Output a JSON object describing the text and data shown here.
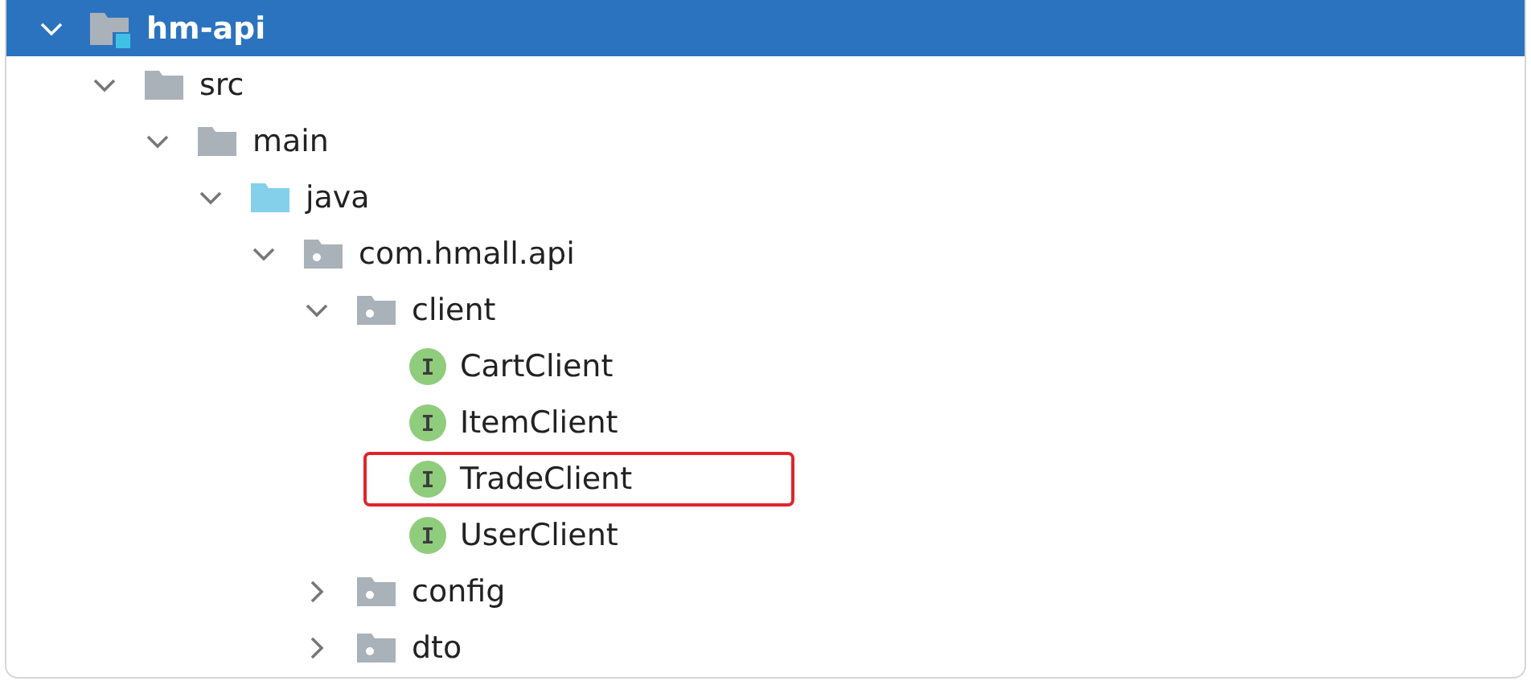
{
  "tree": {
    "label": "hm-api",
    "kind": "module",
    "expanded": true,
    "selected": true,
    "children": [
      {
        "label": "src",
        "kind": "folder",
        "expanded": true,
        "selected": false,
        "children": [
          {
            "label": "main",
            "kind": "folder",
            "expanded": true,
            "selected": false,
            "children": [
              {
                "label": "java",
                "kind": "source_root",
                "expanded": true,
                "selected": false,
                "children": [
                  {
                    "label": "com.hmall.api",
                    "kind": "package",
                    "expanded": true,
                    "selected": false,
                    "children": [
                      {
                        "label": "client",
                        "kind": "package",
                        "expanded": true,
                        "selected": false,
                        "children": [
                          {
                            "label": "CartClient",
                            "kind": "interface",
                            "selected": false,
                            "highlighted": false
                          },
                          {
                            "label": "ItemClient",
                            "kind": "interface",
                            "selected": false,
                            "highlighted": false
                          },
                          {
                            "label": "TradeClient",
                            "kind": "interface",
                            "selected": false,
                            "highlighted": true
                          },
                          {
                            "label": "UserClient",
                            "kind": "interface",
                            "selected": false,
                            "highlighted": false
                          }
                        ]
                      },
                      {
                        "label": "config",
                        "kind": "package",
                        "expanded": false,
                        "selected": false
                      },
                      {
                        "label": "dto",
                        "kind": "package",
                        "expanded": false,
                        "selected": false
                      }
                    ]
                  }
                ]
              }
            ]
          }
        ]
      }
    ]
  }
}
